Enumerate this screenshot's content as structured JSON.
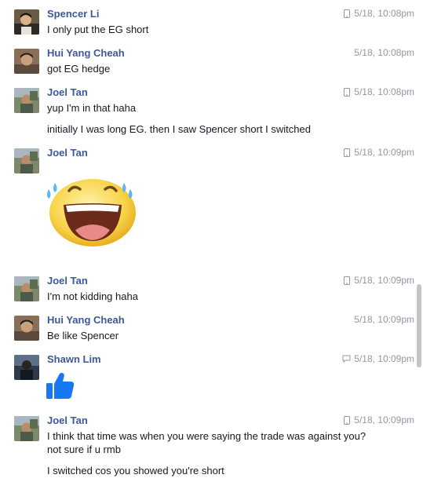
{
  "messages": [
    {
      "sender": "Spencer Li",
      "time": "5/18, 10:08pm",
      "source_icon": "mobile-icon",
      "lines": [
        "I only put the EG short"
      ]
    },
    {
      "sender": "Hui Yang Cheah",
      "time": "5/18, 10:08pm",
      "source_icon": "",
      "lines": [
        "got EG hedge"
      ]
    },
    {
      "sender": "Joel Tan",
      "time": "5/18, 10:08pm",
      "source_icon": "mobile-icon",
      "lines": [
        "yup I'm in that haha",
        "initially I was long EG. then I saw Spencer short I switched"
      ]
    },
    {
      "sender": "Joel Tan",
      "time": "5/18, 10:09pm",
      "source_icon": "mobile-icon",
      "sticker": "laughing-tears-sticker",
      "lines": []
    },
    {
      "sender": "Joel Tan",
      "time": "5/18, 10:09pm",
      "source_icon": "mobile-icon",
      "lines": [
        "I'm not kidding haha"
      ]
    },
    {
      "sender": "Hui Yang Cheah",
      "time": "5/18, 10:09pm",
      "source_icon": "",
      "lines": [
        "Be like Spencer"
      ]
    },
    {
      "sender": "Shawn Lim",
      "time": "5/18, 10:09pm",
      "source_icon": "chat-bubble-icon",
      "sticker": "thumbs-up-like",
      "lines": []
    },
    {
      "sender": "Joel Tan",
      "time": "5/18, 10:09pm",
      "source_icon": "mobile-icon",
      "lines": [
        "I think that time was when you were saying the trade was against you?",
        "not sure if u rmb",
        "I switched cos you showed you're short"
      ]
    }
  ],
  "colors": {
    "name": "#3b5998",
    "text": "#141823",
    "meta": "#9197a3",
    "like": "#1877f2"
  }
}
